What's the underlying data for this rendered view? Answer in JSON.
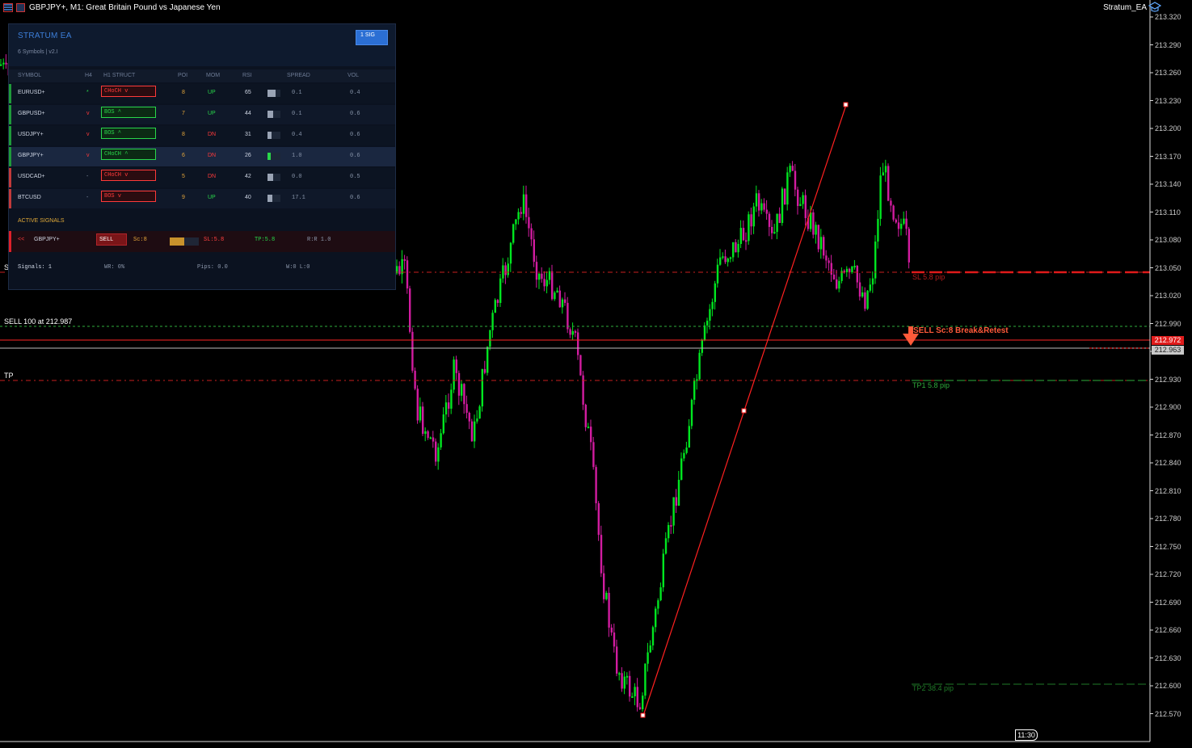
{
  "window": {
    "title": "GBPJPY+, M1:  Great Britain Pound vs Japanese Yen",
    "ea_label": "Stratum_EA"
  },
  "icons": [
    "chart-window-icon",
    "chart-icon-2",
    "graduation-cap-icon"
  ],
  "price_axis": {
    "labels": [
      "213.320",
      "213.290",
      "213.260",
      "213.230",
      "213.200",
      "213.170",
      "213.140",
      "213.110",
      "213.080",
      "213.050",
      "213.020",
      "212.990",
      "212.960",
      "212.930",
      "212.900",
      "212.870",
      "212.840",
      "212.810",
      "212.780",
      "212.750",
      "212.720",
      "212.690",
      "212.660",
      "212.630",
      "212.600",
      "212.570"
    ],
    "bid_tag": "212.972",
    "ask_tag": "212.963"
  },
  "chart_labels": {
    "sell_order": "SELL 100 at 212.987",
    "tp_left": "TP",
    "s_left": "S",
    "sl_right": "SL 5.8 pip",
    "signal_text": "SELL Sc:8 Break&Retest",
    "tp1_right": "TP1 5.8 pip",
    "tp2_right": "TP2 38.4 pip",
    "current_time": "11:30"
  },
  "colors": {
    "bull": "#00e620",
    "bear": "#d21ca0",
    "sell_red": "#ff2b2b",
    "tp_green": "#2fae3c",
    "accent_blue": "#2b6fd4"
  },
  "panel": {
    "title": "STRATUM EA",
    "subtitle": "6 Symbols | v2.I",
    "signal_badge": "1 SIG",
    "headers": [
      "SYMBOL",
      "H4",
      "H1 STRUCT",
      "POI",
      "MOM",
      "RSI",
      "SPREAD",
      "VOL"
    ],
    "rows": [
      {
        "symbol": "EURUSD+",
        "h4": "*",
        "struct": "CHoCH v",
        "poi": "8",
        "mom": "UP",
        "rsi": "65",
        "spread": "0.1",
        "vol": "0.4",
        "bias": "bear",
        "rsi_value": 65
      },
      {
        "symbol": "GBPUSD+",
        "h4": "v",
        "struct": "BOS ^",
        "poi": "7",
        "mom": "UP",
        "rsi": "44",
        "spread": "0.1",
        "vol": "0.6",
        "bias": "bull",
        "rsi_value": 44
      },
      {
        "symbol": "USDJPY+",
        "h4": "v",
        "struct": "BOS ^",
        "poi": "8",
        "mom": "DN",
        "rsi": "31",
        "spread": "0.4",
        "vol": "0.6",
        "bias": "bull",
        "rsi_value": 31
      },
      {
        "symbol": "GBPJPY+",
        "h4": "v",
        "struct": "CHoCH ^",
        "poi": "6",
        "mom": "DN",
        "rsi": "26",
        "spread": "1.0",
        "vol": "0.6",
        "bias": "bull",
        "rsi_value": 26
      },
      {
        "symbol": "USDCAD+",
        "h4": "-",
        "struct": "CHoCH v",
        "poi": "5",
        "mom": "DN",
        "rsi": "42",
        "spread": "0.0",
        "vol": "0.5",
        "bias": "bear",
        "rsi_value": 42
      },
      {
        "symbol": "BTCUSD",
        "h4": "-",
        "struct": "BOS v",
        "poi": "9",
        "mom": "UP",
        "rsi": "40",
        "spread": "17.1",
        "vol": "0.6",
        "bias": "bear",
        "rsi_value": 40
      }
    ],
    "active_title": "ACTIVE SIGNALS",
    "active_signal": {
      "arrow": "<<",
      "symbol": "GBPJPY+",
      "side": "SELL",
      "score": "Sc:8",
      "score_value": 0.5,
      "sl": "SL:5.8",
      "tp": "TP:5.8",
      "rr": "R:R 1.0"
    },
    "stats": {
      "signals": "Signals: 1",
      "wr": "WR: 0%",
      "pips": "Pips: 0.0",
      "wl": "W:0 L:0"
    }
  }
}
